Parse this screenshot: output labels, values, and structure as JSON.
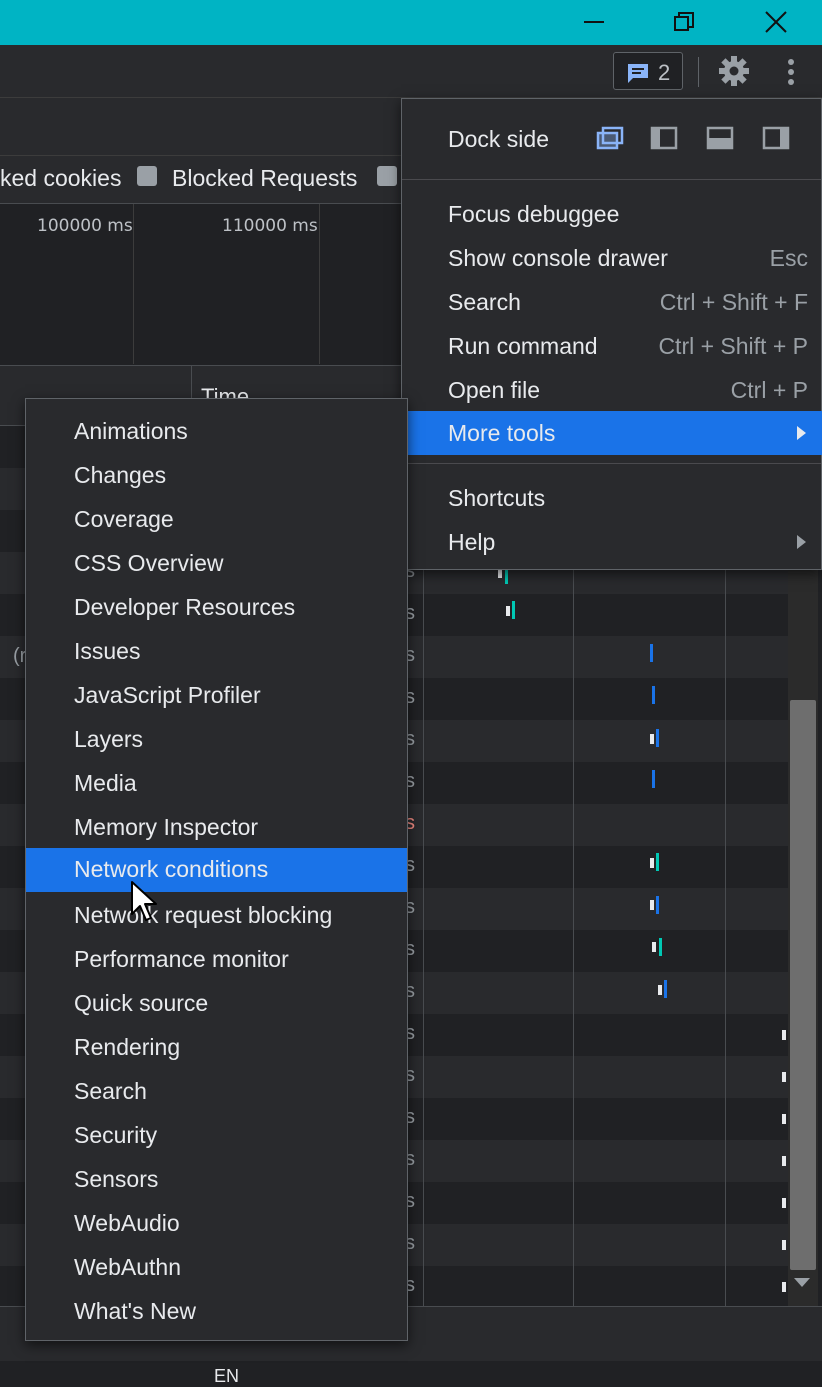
{
  "window": {
    "controls": [
      "minimize-icon",
      "restore-icon",
      "close-icon"
    ]
  },
  "toolbar": {
    "issues_count": "2",
    "icons": [
      "issues-icon",
      "gear-icon",
      "kebab-menu-icon"
    ]
  },
  "network": {
    "checkbox_labels": [
      "ked cookies",
      "Blocked Requests"
    ],
    "overview_ticks": [
      "100000 ms",
      "110000 ms"
    ],
    "column_time": "Time",
    "row_fragment": "(r",
    "row_suffix": "s",
    "taskbar_lang": "EN"
  },
  "main_menu": {
    "dock_side_label": "Dock side",
    "dock_icons": [
      "undock-icon",
      "dock-left-icon",
      "dock-bottom-icon",
      "dock-right-icon"
    ],
    "items": [
      {
        "label": "Focus debuggee",
        "shortcut": ""
      },
      {
        "label": "Show console drawer",
        "shortcut": "Esc"
      },
      {
        "label": "Search",
        "shortcut": "Ctrl + Shift + F"
      },
      {
        "label": "Run command",
        "shortcut": "Ctrl + Shift + P"
      },
      {
        "label": "Open file",
        "shortcut": "Ctrl + P"
      },
      {
        "label": "More tools",
        "shortcut": ""
      },
      {
        "label": "Shortcuts",
        "shortcut": ""
      },
      {
        "label": "Help",
        "shortcut": ""
      }
    ],
    "highlighted": "More tools",
    "accent_color": "#1a73e8"
  },
  "more_tools_menu": {
    "items": [
      "Animations",
      "Changes",
      "Coverage",
      "CSS Overview",
      "Developer Resources",
      "Issues",
      "JavaScript Profiler",
      "Layers",
      "Media",
      "Memory Inspector",
      "Network conditions",
      "Network request blocking",
      "Performance monitor",
      "Quick source",
      "Rendering",
      "Search",
      "Security",
      "Sensors",
      "WebAudio",
      "WebAuthn",
      "What's New"
    ],
    "highlighted": "Network conditions"
  }
}
